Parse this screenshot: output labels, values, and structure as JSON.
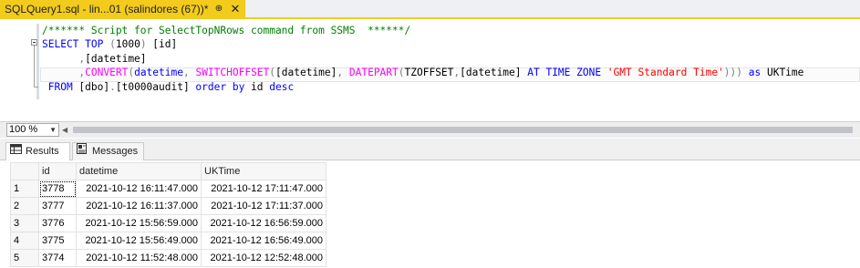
{
  "document_tab": {
    "title": "SQLQuery1.sql - lin...01 (salindores (67))*",
    "pin_glyph": "⊕",
    "close_glyph": "✕"
  },
  "editor": {
    "lines": [
      [
        {
          "t": "/****** Script for SelectTopNRows command from SSMS  ******/",
          "c": "cm"
        }
      ],
      [
        {
          "t": "SELECT ",
          "c": "kw"
        },
        {
          "t": "TOP ",
          "c": "kw"
        },
        {
          "t": "(",
          "c": "op"
        },
        {
          "t": "1000",
          "c": "bk"
        },
        {
          "t": ") ",
          "c": "op"
        },
        {
          "t": "[id]",
          "c": "bk"
        }
      ],
      [
        {
          "t": "      ",
          "c": "bk"
        },
        {
          "t": ",",
          "c": "op"
        },
        {
          "t": "[datetime]",
          "c": "bk"
        }
      ],
      [
        {
          "t": "      ",
          "c": "bk"
        },
        {
          "t": ",",
          "c": "op"
        },
        {
          "t": "CONVERT",
          "c": "fn"
        },
        {
          "t": "(",
          "c": "op"
        },
        {
          "t": "datetime",
          "c": "kw"
        },
        {
          "t": ", ",
          "c": "op"
        },
        {
          "t": "SWITCHOFFSET",
          "c": "fn"
        },
        {
          "t": "(",
          "c": "op"
        },
        {
          "t": "[datetime]",
          "c": "bk"
        },
        {
          "t": ", ",
          "c": "op"
        },
        {
          "t": "DATEPART",
          "c": "fn"
        },
        {
          "t": "(",
          "c": "op"
        },
        {
          "t": "TZOFFSET",
          "c": "bk"
        },
        {
          "t": ",",
          "c": "op"
        },
        {
          "t": "[datetime] ",
          "c": "bk"
        },
        {
          "t": "AT TIME ZONE ",
          "c": "kw"
        },
        {
          "t": "'GMT Standard Time'",
          "c": "st"
        },
        {
          "t": "))) ",
          "c": "op"
        },
        {
          "t": "as ",
          "c": "kw"
        },
        {
          "t": "UKTime",
          "c": "bk"
        }
      ],
      [
        {
          "t": " FROM ",
          "c": "kw"
        },
        {
          "t": "[dbo]",
          "c": "bk"
        },
        {
          "t": ".",
          "c": "op"
        },
        {
          "t": "[t0000audit] ",
          "c": "bk"
        },
        {
          "t": "order by ",
          "c": "kw"
        },
        {
          "t": "id ",
          "c": "bk"
        },
        {
          "t": "desc",
          "c": "kw"
        }
      ]
    ]
  },
  "zoom": {
    "value": "100 %"
  },
  "results_tabs": {
    "results_label": "Results",
    "messages_label": "Messages"
  },
  "grid": {
    "columns": [
      "id",
      "datetime",
      "UKTime"
    ],
    "rows": [
      {
        "row": "1",
        "id": "3778",
        "datetime": "2021-10-12 16:11:47.000",
        "UKTime": "2021-10-12 17:11:47.000"
      },
      {
        "row": "2",
        "id": "3777",
        "datetime": "2021-10-12 16:11:37.000",
        "UKTime": "2021-10-12 17:11:37.000"
      },
      {
        "row": "3",
        "id": "3776",
        "datetime": "2021-10-12 15:56:59.000",
        "UKTime": "2021-10-12 16:56:59.000"
      },
      {
        "row": "4",
        "id": "3775",
        "datetime": "2021-10-12 15:56:49.000",
        "UKTime": "2021-10-12 16:56:49.000"
      },
      {
        "row": "5",
        "id": "3774",
        "datetime": "2021-10-12 11:52:48.000",
        "UKTime": "2021-10-12 12:52:48.000"
      }
    ]
  },
  "colors": {
    "tab_accent": "#f2cb1d",
    "keyword": "#0000ff",
    "function": "#ff00ff",
    "comment": "#008000",
    "string": "#ff0000",
    "operator": "#808080"
  },
  "icons": {
    "pin": "pin-icon",
    "close": "close-icon",
    "results": "grid-icon",
    "messages": "messages-icon",
    "zoom_dropdown": "chevron-down-icon",
    "scroll_left": "scroll-left-arrow-icon"
  }
}
